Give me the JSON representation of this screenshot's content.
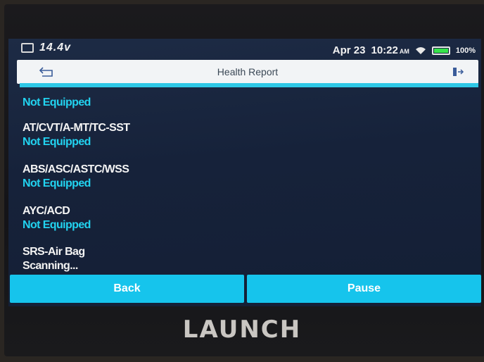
{
  "status_bar": {
    "voltage": "14.4v",
    "date": "Apr 23",
    "time": "10:22",
    "ampm": "AM",
    "battery_percent": "100%",
    "battery_level": 1.0,
    "battery_color": "#37e34b"
  },
  "header": {
    "title": "Health Report"
  },
  "items": [
    {
      "name": "",
      "status": "Not Equipped"
    },
    {
      "name": "AT/CVT/A-MT/TC-SST",
      "status": "Not Equipped"
    },
    {
      "name": "ABS/ASC/ASTC/WSS",
      "status": "Not Equipped"
    },
    {
      "name": "AYC/ACD",
      "status": "Not Equipped"
    },
    {
      "name": "SRS-Air Bag",
      "status": "Scanning..."
    }
  ],
  "buttons": {
    "back": "Back",
    "pause": "Pause"
  },
  "brand": "LAUNCH",
  "colors": {
    "accent": "#16c4ec",
    "status_cyan": "#22d3f0"
  }
}
